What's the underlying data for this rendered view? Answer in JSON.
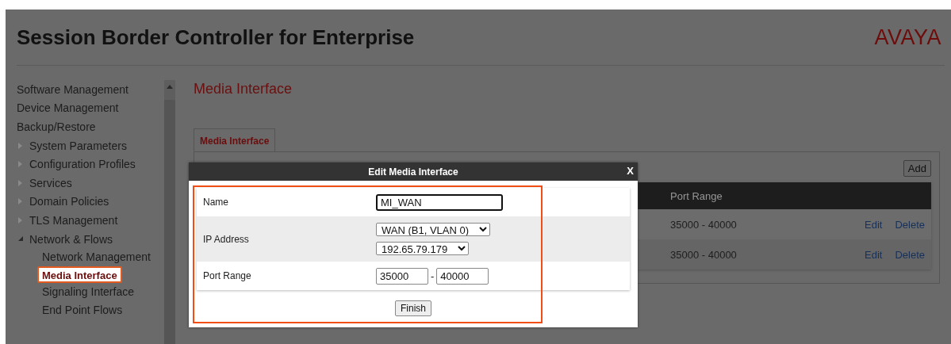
{
  "header": {
    "title": "Session Border Controller for Enterprise",
    "logo": "AVAYA"
  },
  "sidebar": {
    "items": [
      {
        "kind": "link",
        "label": "Software Management",
        "selected": false
      },
      {
        "kind": "link",
        "label": "Device Management",
        "selected": false
      },
      {
        "kind": "link",
        "label": "Backup/Restore",
        "selected": false
      },
      {
        "kind": "group",
        "label": "System Parameters",
        "expanded": false,
        "selected": false
      },
      {
        "kind": "group",
        "label": "Configuration Profiles",
        "expanded": false,
        "selected": false
      },
      {
        "kind": "group",
        "label": "Services",
        "expanded": false,
        "selected": false
      },
      {
        "kind": "group",
        "label": "Domain Policies",
        "expanded": false,
        "selected": false
      },
      {
        "kind": "group",
        "label": "TLS Management",
        "expanded": false,
        "selected": false
      },
      {
        "kind": "group",
        "label": "Network & Flows",
        "expanded": true,
        "selected": false,
        "children": [
          {
            "label": "Network Management",
            "selected": false
          },
          {
            "label": "Media Interface",
            "selected": true
          },
          {
            "label": "Signaling Interface",
            "selected": false
          },
          {
            "label": "End Point Flows",
            "selected": false
          }
        ]
      }
    ]
  },
  "page": {
    "title": "Media Interface",
    "tabs": [
      {
        "label": "Media Interface",
        "selected": true
      }
    ],
    "add_button": "Add",
    "table": {
      "columns": [
        "Port Range"
      ],
      "rows": [
        {
          "port_range": "35000 - 40000",
          "actions": [
            "Edit",
            "Delete"
          ]
        },
        {
          "port_range": "35000 - 40000",
          "actions": [
            "Edit",
            "Delete"
          ]
        }
      ]
    }
  },
  "dialog": {
    "title": "Edit Media Interface",
    "close": "X",
    "fields": [
      {
        "kind": "text",
        "label": "Name",
        "value": "MI_WAN"
      },
      {
        "kind": "selects",
        "label": "IP Address",
        "options": [
          "WAN (B1, VLAN 0)",
          "192.65.79.179"
        ]
      },
      {
        "kind": "range",
        "label": "Port Range",
        "from": "35000",
        "separator": "-",
        "to": "40000"
      }
    ],
    "button": "Finish"
  }
}
